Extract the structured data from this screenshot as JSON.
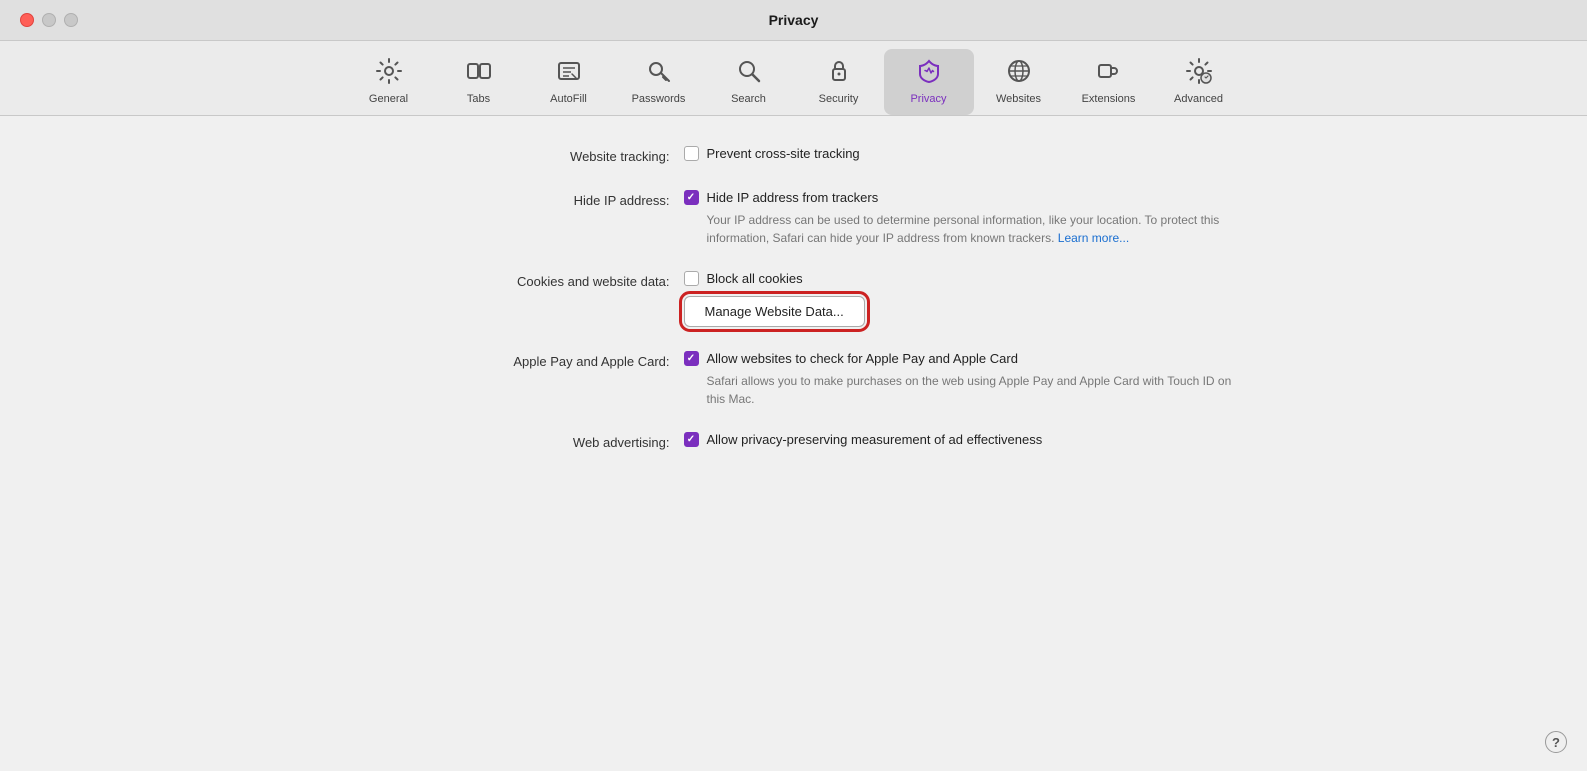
{
  "window": {
    "title": "Privacy"
  },
  "toolbar": {
    "items": [
      {
        "id": "general",
        "label": "General",
        "icon": "⚙️",
        "active": false
      },
      {
        "id": "tabs",
        "label": "Tabs",
        "icon": "⧉",
        "active": false
      },
      {
        "id": "autofill",
        "label": "AutoFill",
        "icon": "✏️",
        "active": false
      },
      {
        "id": "passwords",
        "label": "Passwords",
        "icon": "🔑",
        "active": false
      },
      {
        "id": "search",
        "label": "Search",
        "icon": "🔍",
        "active": false
      },
      {
        "id": "security",
        "label": "Security",
        "icon": "🔒",
        "active": false
      },
      {
        "id": "privacy",
        "label": "Privacy",
        "icon": "✋",
        "active": true
      },
      {
        "id": "websites",
        "label": "Websites",
        "icon": "🌐",
        "active": false
      },
      {
        "id": "extensions",
        "label": "Extensions",
        "icon": "🧩",
        "active": false
      },
      {
        "id": "advanced",
        "label": "Advanced",
        "icon": "⚙️",
        "active": false
      }
    ]
  },
  "settings": {
    "website_tracking": {
      "label": "Website tracking:",
      "checkbox_checked": false,
      "text": "Prevent cross-site tracking"
    },
    "hide_ip": {
      "label": "Hide IP address:",
      "checkbox_checked": true,
      "text": "Hide IP address from trackers",
      "description": "Your IP address can be used to determine personal information, like your location. To protect this information, Safari can hide your IP address from known trackers.",
      "link_text": "Learn more..."
    },
    "cookies": {
      "label": "Cookies and website data:",
      "checkbox_checked": false,
      "block_text": "Block all cookies",
      "manage_btn": "Manage Website Data..."
    },
    "apple_pay": {
      "label": "Apple Pay and Apple Card:",
      "checkbox_checked": true,
      "text": "Allow websites to check for Apple Pay and Apple Card",
      "description": "Safari allows you to make purchases on the web using Apple Pay and Apple Card with Touch ID on this Mac."
    },
    "web_advertising": {
      "label": "Web advertising:",
      "checkbox_checked": true,
      "text": "Allow privacy-preserving measurement of ad effectiveness"
    }
  },
  "help": "?"
}
